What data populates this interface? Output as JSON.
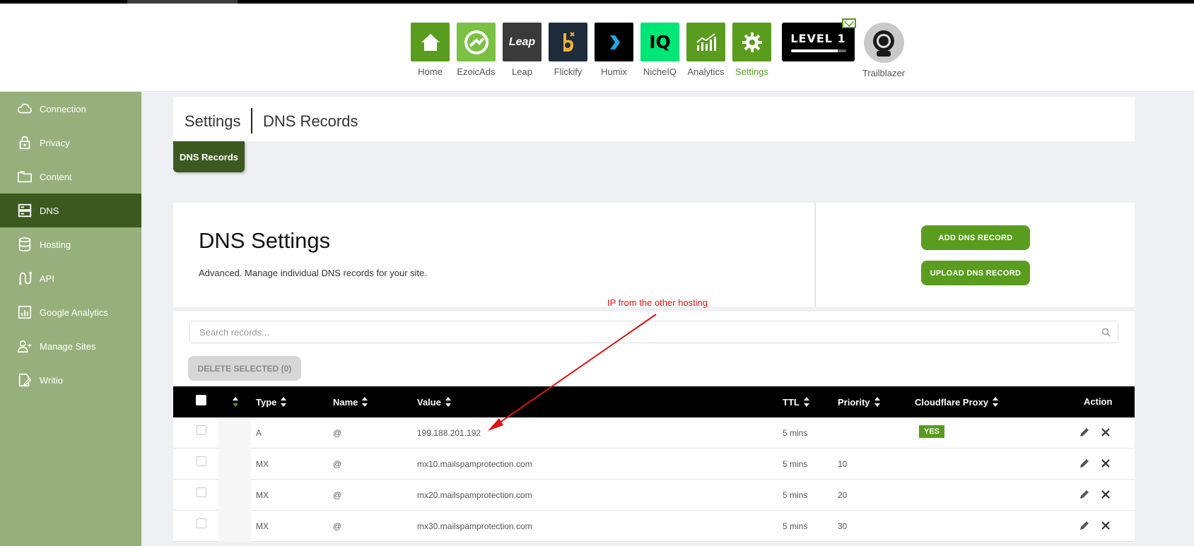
{
  "header": {
    "apps": [
      {
        "label": "Home",
        "icon": "home-icon",
        "color": "#5a9d1e"
      },
      {
        "label": "EzoicAds",
        "icon": "ezoicads-icon",
        "color": "#7ac143"
      },
      {
        "label": "Leap",
        "icon": "leap-icon",
        "color": "#3a3a3a",
        "tile_text": "Leap"
      },
      {
        "label": "Flickify",
        "icon": "flickify-icon",
        "color": "#1d2b3a"
      },
      {
        "label": "Humix",
        "icon": "humix-icon",
        "color": "#000000"
      },
      {
        "label": "NicheIQ",
        "icon": "nicheiq-icon",
        "color": "#00e676",
        "tile_text": "IQ"
      },
      {
        "label": "Analytics",
        "icon": "analytics-icon",
        "color": "#5a9d1e"
      },
      {
        "label": "Settings",
        "icon": "gear-icon",
        "color": "#5a9d1e",
        "active": true
      }
    ],
    "level_text": "LEVEL 1",
    "level_progress": 0.85,
    "user_label": "Trailblazer"
  },
  "sidebar": {
    "items": [
      {
        "label": "Connection",
        "icon": "cloud-icon"
      },
      {
        "label": "Privacy",
        "icon": "lock-icon"
      },
      {
        "label": "Content",
        "icon": "folder-icon"
      },
      {
        "label": "DNS",
        "icon": "server-icon",
        "active": true
      },
      {
        "label": "Hosting",
        "icon": "database-icon"
      },
      {
        "label": "API",
        "icon": "api-icon"
      },
      {
        "label": "Google Analytics",
        "icon": "chart-icon"
      },
      {
        "label": "Manage Sites",
        "icon": "users-icon"
      },
      {
        "label": "Writio",
        "icon": "writio-icon"
      }
    ]
  },
  "breadcrumb": {
    "section": "Settings",
    "page": "DNS Records"
  },
  "tab": {
    "label": "DNS Records"
  },
  "dns_panel": {
    "title": "DNS Settings",
    "description": "Advanced. Manage individual DNS records for your site.",
    "add_button": "ADD DNS RECORD",
    "upload_button": "UPLOAD DNS RECORD"
  },
  "search": {
    "placeholder": "Search records..."
  },
  "delete_button": "DELETE SELECTED (0)",
  "table": {
    "columns": {
      "type": "Type",
      "name": "Name",
      "value": "Value",
      "ttl": "TTL",
      "priority": "Priority",
      "proxy": "Cloudflare Proxy",
      "action": "Action"
    },
    "rows": [
      {
        "type": "A",
        "name": "@",
        "value": "199.188.201.192",
        "ttl": "5 mins",
        "priority": "",
        "proxy": "YES"
      },
      {
        "type": "MX",
        "name": "@",
        "value": "mx10.mailspamprotection.com",
        "ttl": "5 mins",
        "priority": "10",
        "proxy": ""
      },
      {
        "type": "MX",
        "name": "@",
        "value": "mx20.mailspamprotection.com",
        "ttl": "5 mins",
        "priority": "20",
        "proxy": ""
      },
      {
        "type": "MX",
        "name": "@",
        "value": "mx30.mailspamprotection.com",
        "ttl": "5 mins",
        "priority": "30",
        "proxy": ""
      }
    ]
  },
  "annotation": {
    "text": "IP from the other hosting",
    "color": "#e11111"
  },
  "colors": {
    "accent": "#5a9d1e",
    "sidebar": "#97b07b",
    "sidebar_active": "#3c5a20"
  }
}
